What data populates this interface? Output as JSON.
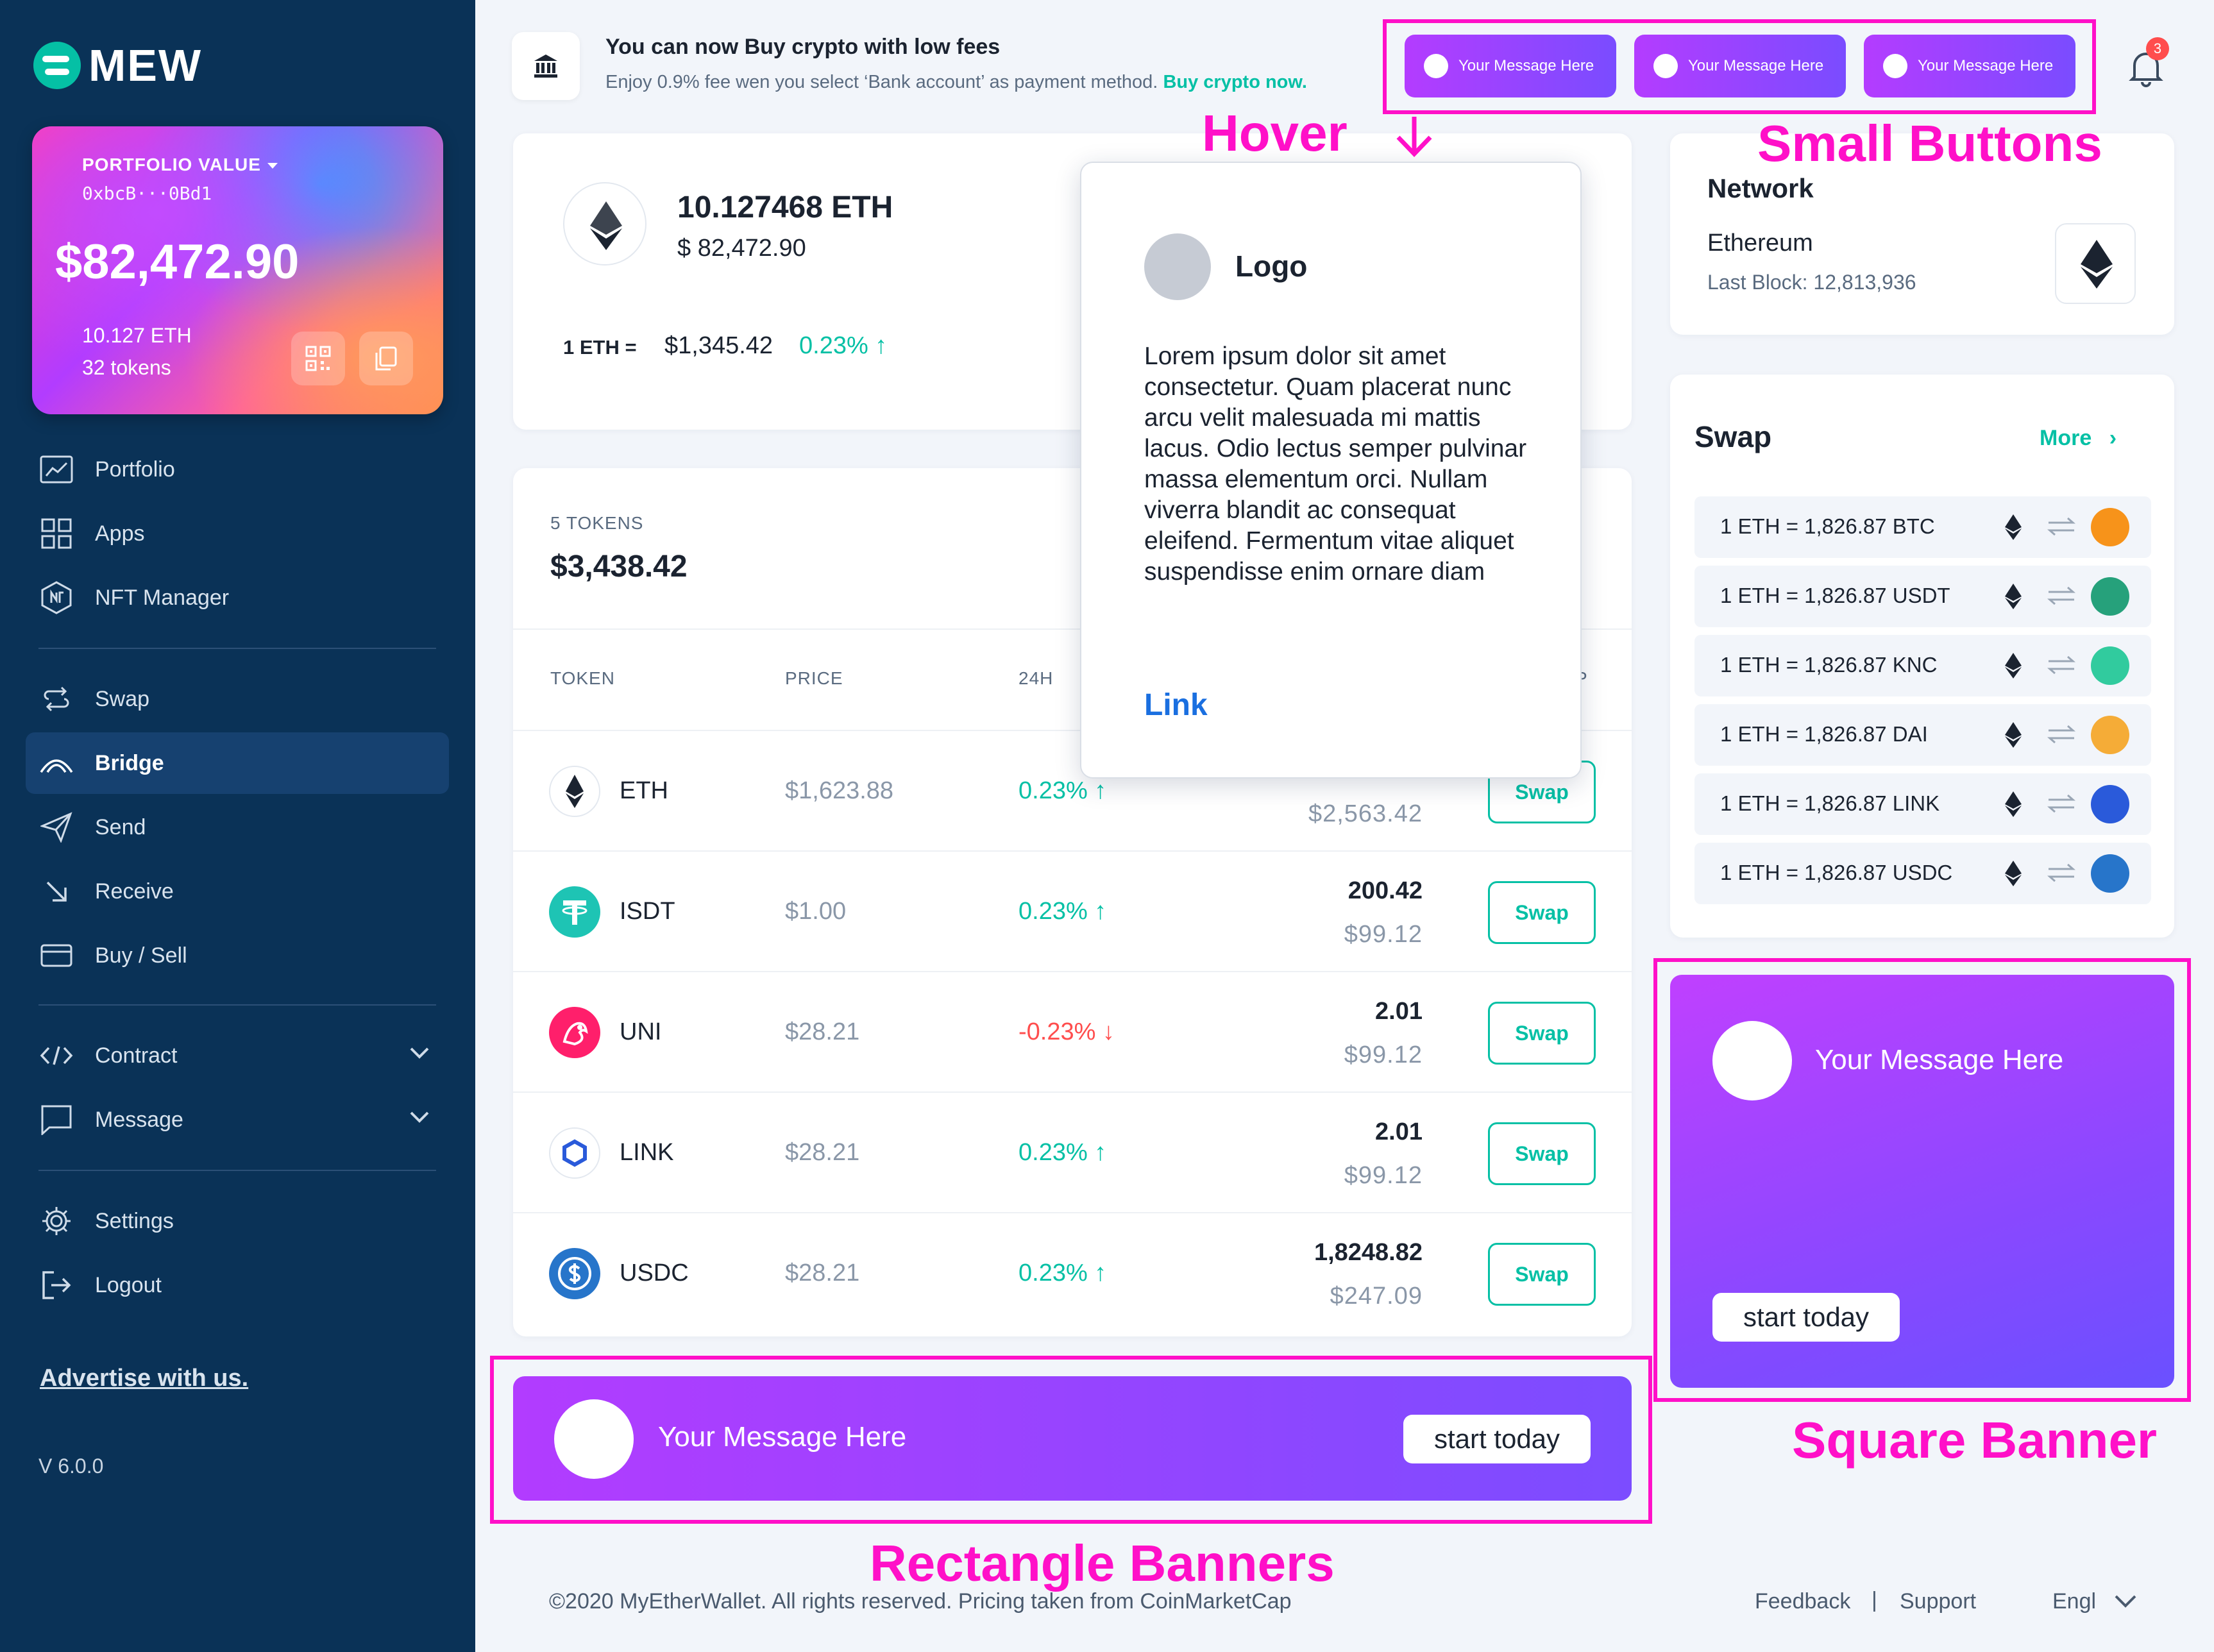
{
  "app": {
    "brand": "MEW"
  },
  "portfolio": {
    "label": "PORTFOLIO VALUE",
    "address": "0xbcB···0Bd1",
    "value": "$82,472.90",
    "eth": "10.127 ETH",
    "tokens": "32 tokens"
  },
  "nav": {
    "portfolio": "Portfolio",
    "apps": "Apps",
    "nft": "NFT Manager",
    "swap": "Swap",
    "bridge": "Bridge",
    "send": "Send",
    "receive": "Receive",
    "buy_sell": "Buy / Sell",
    "contract": "Contract",
    "message": "Message",
    "settings": "Settings",
    "logout": "Logout",
    "active": "Bridge"
  },
  "sidebar_footer": {
    "advertise": "Advertise with us.",
    "version": "V 6.0.0"
  },
  "promo": {
    "title": "You can now Buy crypto with low fees",
    "subtitle": "Enjoy 0.9% fee wen you select ‘Bank account’ as payment method.",
    "link": "Buy crypto now."
  },
  "small_buttons": [
    "Your Message Here",
    "Your Message Here",
    "Your Message Here"
  ],
  "notifications": {
    "count": "3"
  },
  "eth_summary": {
    "amount": "10.127468 ETH",
    "usd": "$ 82,472.90",
    "rate_label": "1 ETH =",
    "rate": "$1,345.42",
    "change": "0.23% ↑"
  },
  "tokens": {
    "count_label": "5 TOKENS",
    "total": "$3,438.42",
    "headers": {
      "token": "TOKEN",
      "price": "PRICE",
      "change": "24H",
      "partial": "P"
    },
    "rows": [
      {
        "name": "ETH",
        "price": "$1,623.88",
        "change": "0.23% ↑",
        "balance": "",
        "value": "$2,563.42",
        "action": "Swap"
      },
      {
        "name": "ISDT",
        "price": "$1.00",
        "change": "0.23% ↑",
        "balance": "200.42",
        "value": "$99.12",
        "action": "Swap"
      },
      {
        "name": "UNI",
        "price": "$28.21",
        "change": "-0.23% ↓",
        "balance": "2.01",
        "value": "$99.12",
        "action": "Swap"
      },
      {
        "name": "LINK",
        "price": "$28.21",
        "change": "0.23% ↑",
        "balance": "2.01",
        "value": "$99.12",
        "action": "Swap"
      },
      {
        "name": "USDC",
        "price": "$28.21",
        "change": "0.23% ↑",
        "balance": "1,8248.82",
        "value": "$247.09",
        "action": "Swap"
      }
    ]
  },
  "network": {
    "title": "Network",
    "name": "Ethereum",
    "last_block": "Last Block: 12,813,936"
  },
  "swap_panel": {
    "title": "Swap",
    "more": "More",
    "rates": [
      {
        "text": "1 ETH = 1,826.87 BTC",
        "coin_color": "#f7931a"
      },
      {
        "text": "1 ETH = 1,826.87 USDT",
        "coin_color": "#26a17b"
      },
      {
        "text": "1 ETH = 1,826.87 KNC",
        "coin_color": "#31cb9e"
      },
      {
        "text": "1 ETH = 1,826.87 DAI",
        "coin_color": "#f5ac37"
      },
      {
        "text": "1 ETH = 1,826.87 LINK",
        "coin_color": "#2a5ada"
      },
      {
        "text": "1 ETH = 1,826.87 USDC",
        "coin_color": "#2775ca"
      }
    ]
  },
  "rect_banner": {
    "message": "Your Message Here",
    "button": "start today"
  },
  "square_banner": {
    "message": "Your Message Here",
    "button": "start today"
  },
  "popover": {
    "logo": "Logo",
    "body": "Lorem ipsum dolor sit amet consectetur. Quam placerat nunc arcu velit malesuada mi mattis lacus. Odio lectus semper pulvinar massa elementum orci. Nullam viverra blandit ac consequat eleifend. Fermentum vitae aliquet suspendisse enim ornare diam",
    "link": "Link"
  },
  "annotations": {
    "hover": "Hover",
    "small_buttons": "Small Buttons",
    "square_banner": "Square Banner",
    "rectangle_banners": "Rectangle Banners"
  },
  "footer": {
    "copyright": "©2020 MyEtherWallet. All rights reserved. Pricing taken from CoinMarketCap",
    "feedback": "Feedback",
    "separator": "|",
    "support": "Support",
    "language": "Engl"
  },
  "colors": {
    "sidebar": "#0a3257",
    "accent": "#05c0a5",
    "banner_start": "#b23cff",
    "banner_end": "#7c4cff",
    "annotation": "#ff10c8",
    "negative": "#ff4d4d"
  }
}
